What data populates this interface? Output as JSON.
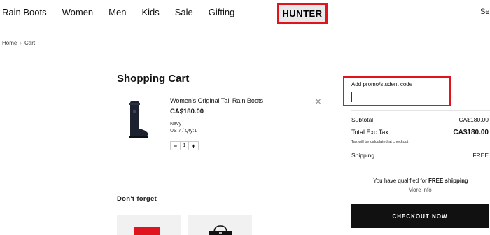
{
  "nav": {
    "links": [
      "Rain Boots",
      "Women",
      "Men",
      "Kids",
      "Sale",
      "Gifting"
    ],
    "logo": "HUNTER",
    "search_label": "Se"
  },
  "breadcrumb": {
    "home": "Home",
    "separator": "›",
    "current": "Cart"
  },
  "cart": {
    "title": "Shopping Cart",
    "item": {
      "name": "Women's Original Tall Rain Boots",
      "price": "CA$180.00",
      "color": "Navy",
      "size_qty": "US 7 / Qty:1",
      "quantity": "1",
      "decrement": "−",
      "increment": "+",
      "remove_icon": "close-icon"
    }
  },
  "dont_forget": {
    "title": "Don't forget"
  },
  "promo": {
    "label": "Add promo/student code",
    "value": ""
  },
  "summary": {
    "subtotal_label": "Subtotal",
    "subtotal_value": "CA$180.00",
    "total_label": "Total Exc Tax",
    "total_value": "CA$180.00",
    "tax_note": "Tax will be calculated at checkout",
    "shipping_label": "Shipping",
    "shipping_value": "FREE",
    "qualified_prefix": "You have qualified for ",
    "qualified_bold": "FREE shipping",
    "more_info": "More info",
    "checkout_label": "CHECKOUT NOW"
  },
  "colors": {
    "accent_red": "#e0141e",
    "button_bg": "#111111"
  }
}
